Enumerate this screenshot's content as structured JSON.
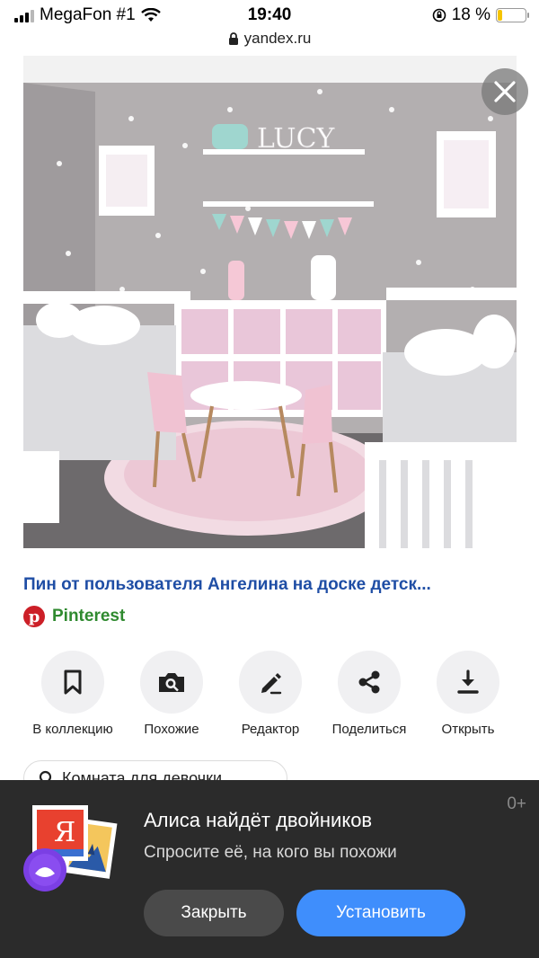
{
  "status_bar": {
    "carrier": "MegaFon #1",
    "time": "19:40",
    "battery_text": "18 %",
    "battery_level": 0.18,
    "url": "yandex.ru"
  },
  "pin": {
    "title": "Пин от пользователя Ангелина на доске детск...",
    "source": "Pinterest",
    "image_caption": "LUCY"
  },
  "actions": [
    {
      "label": "В коллекцию",
      "icon": "bookmark-icon"
    },
    {
      "label": "Похожие",
      "icon": "camera-search-icon"
    },
    {
      "label": "Редактор",
      "icon": "pencil-icon"
    },
    {
      "label": "Поделиться",
      "icon": "share-icon"
    },
    {
      "label": "Открыть",
      "icon": "download-icon"
    }
  ],
  "search_chip": {
    "text": "Комната для девочки"
  },
  "banner": {
    "age_rating": "0+",
    "title": "Алиса найдёт двойников",
    "subtitle": "Спросите её, на кого вы похожи",
    "close_label": "Закрыть",
    "install_label": "Установить",
    "art_letter": "Я"
  },
  "colors": {
    "title_link": "#1f4ea5",
    "source_green": "#2f8a2f",
    "pinterest_red": "#cc1f27",
    "banner_bg": "#2b2b2b",
    "install_blue": "#3f8efc",
    "action_circle": "#f0f0f2"
  }
}
